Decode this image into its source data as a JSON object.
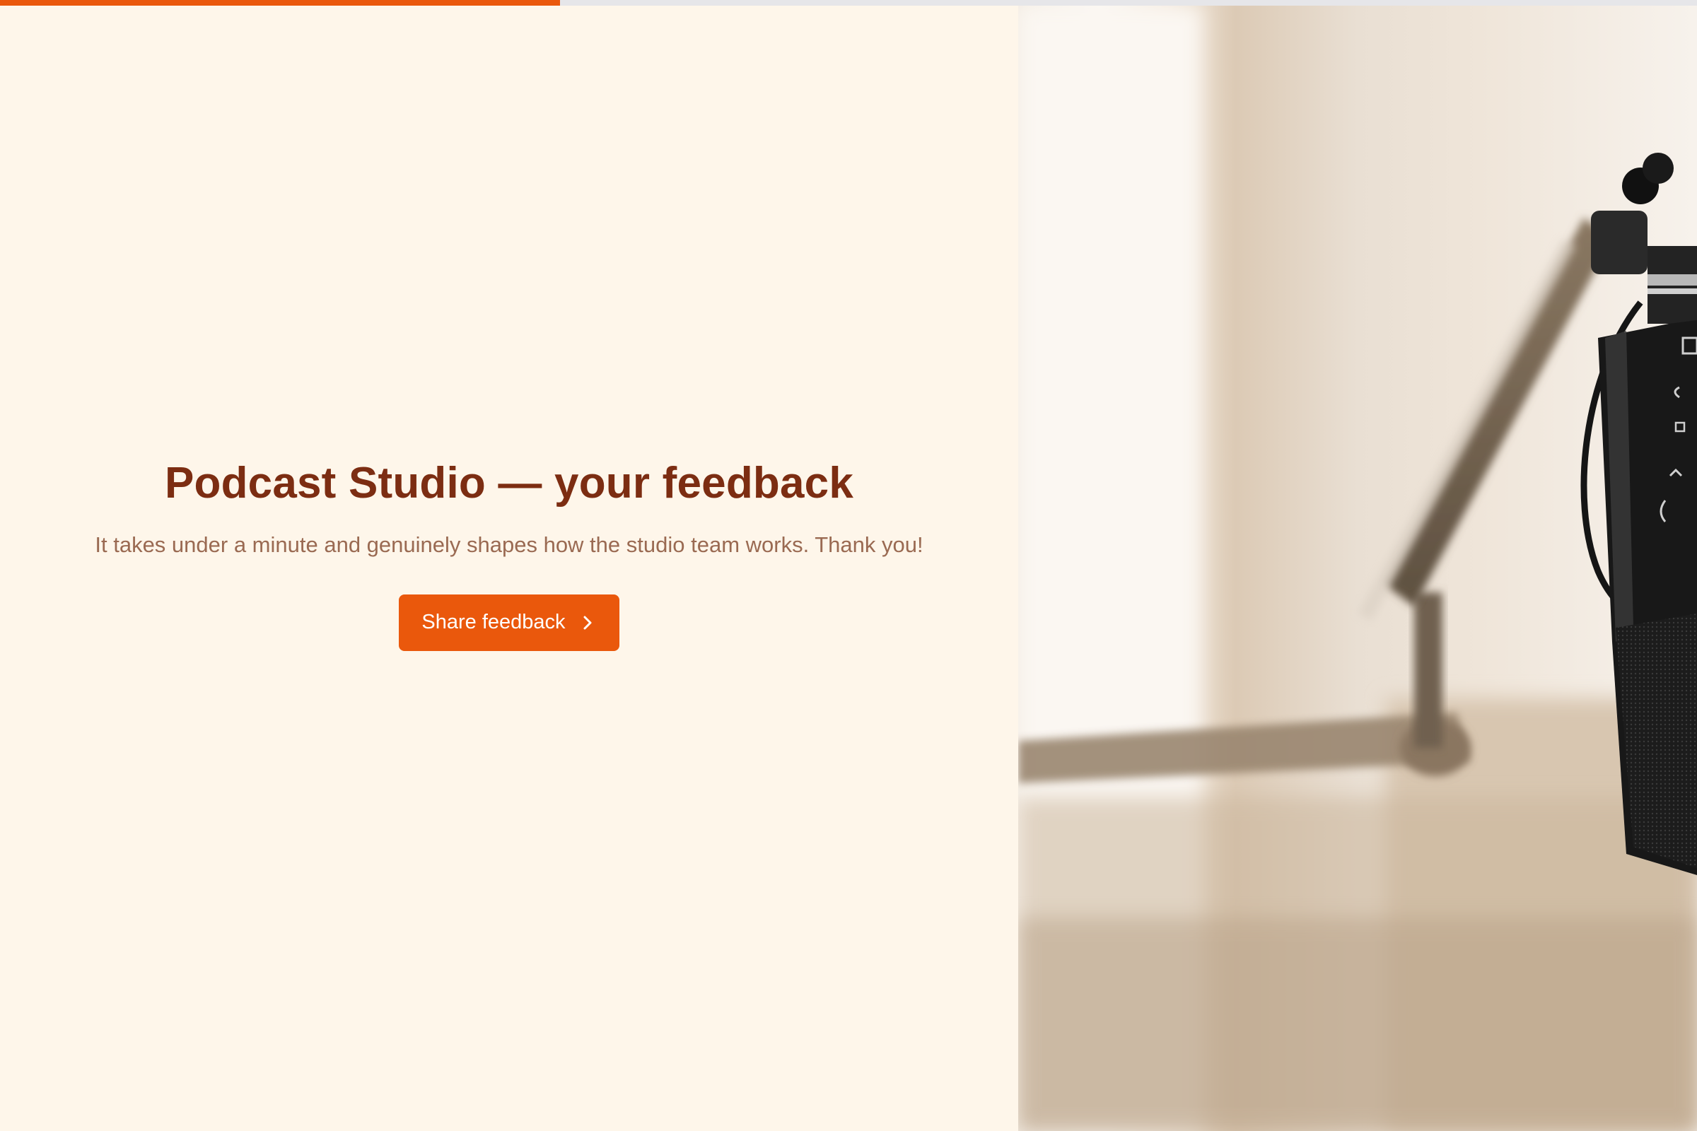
{
  "survey": {
    "progress_percent": 33
  },
  "intro": {
    "title": "Podcast Studio — your feedback",
    "subtitle": "It takes under a minute and genuinely shapes how the studio team works. Thank you!",
    "cta_label": "Share feedback"
  },
  "icons": {
    "cta_icon": "chevron-right-icon"
  },
  "colors": {
    "accent": "#ea580c",
    "title": "#7c2d12",
    "subtitle": "#9a6a52",
    "background": "#fef6ea"
  }
}
